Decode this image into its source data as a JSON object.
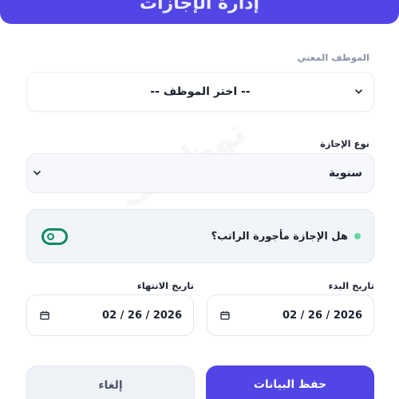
{
  "header": {
    "title": "إدارة الإجازات"
  },
  "employee": {
    "label": "الموظف المعني",
    "placeholder_option": "-- اختر الموظف --"
  },
  "leave_type": {
    "label": "نوع الإجازة",
    "selected": "سنوية"
  },
  "paid_toggle": {
    "label": "هل الإجازة مأجورة الراتب؟",
    "enabled": true
  },
  "start_date": {
    "label": "تاريخ البدء",
    "value": "02 / 26 / 2026"
  },
  "end_date": {
    "label": "تاريخ الانتهاء",
    "value": "02 / 26 / 2026"
  },
  "actions": {
    "save_label": "حفظ البيانات",
    "cancel_label": "إلغاء"
  },
  "colors": {
    "primary": "#5145e5",
    "toggle_green": "#0e8a5f",
    "dot_green": "#63d6a4"
  }
}
